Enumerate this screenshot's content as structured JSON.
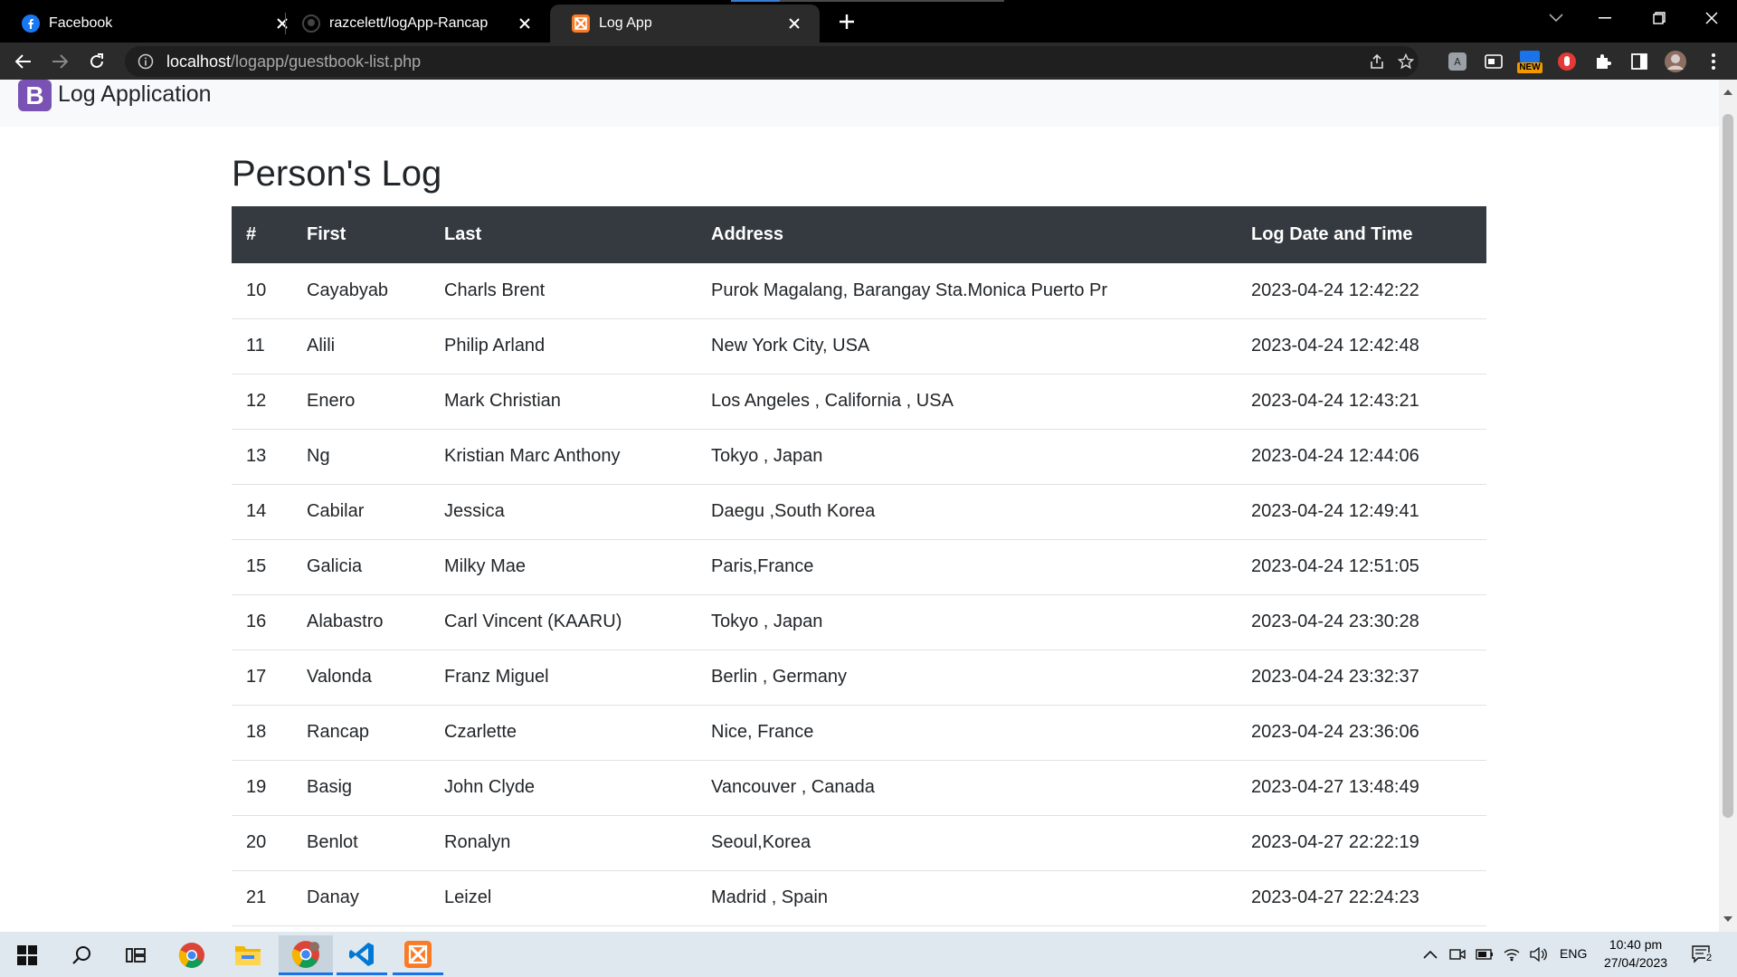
{
  "browser": {
    "tabs": [
      {
        "title": "Facebook",
        "favicon": "facebook-icon",
        "active": false
      },
      {
        "title": "razcelett/logApp-Rancap",
        "favicon": "github-icon",
        "active": false
      },
      {
        "title": "Log App",
        "favicon": "xampp-icon",
        "active": true
      }
    ],
    "url_host": "localhost",
    "url_path": "/logapp/guestbook-list.php",
    "extension_badge": "NEW"
  },
  "navbar": {
    "brand_letter": "B",
    "brand_text": "Log Application"
  },
  "page": {
    "title": "Person's Log",
    "columns": [
      "#",
      "First",
      "Last",
      "Address",
      "Log Date and Time"
    ],
    "rows": [
      {
        "id": "10",
        "first": "Cayabyab",
        "last": "Charls Brent",
        "address": "Purok Magalang, Barangay Sta.Monica Puerto Pr",
        "datetime": "2023-04-24 12:42:22"
      },
      {
        "id": "11",
        "first": "Alili",
        "last": "Philip Arland",
        "address": "New York City, USA",
        "datetime": "2023-04-24 12:42:48"
      },
      {
        "id": "12",
        "first": "Enero",
        "last": "Mark Christian",
        "address": "Los Angeles , California , USA",
        "datetime": "2023-04-24 12:43:21"
      },
      {
        "id": "13",
        "first": "Ng",
        "last": "Kristian Marc Anthony",
        "address": "Tokyo , Japan",
        "datetime": "2023-04-24 12:44:06"
      },
      {
        "id": "14",
        "first": "Cabilar",
        "last": "Jessica",
        "address": "Daegu ,South Korea",
        "datetime": "2023-04-24 12:49:41"
      },
      {
        "id": "15",
        "first": "Galicia",
        "last": "Milky Mae",
        "address": "Paris,France",
        "datetime": "2023-04-24 12:51:05"
      },
      {
        "id": "16",
        "first": "Alabastro",
        "last": "Carl Vincent (KAARU)",
        "address": "Tokyo , Japan",
        "datetime": "2023-04-24 23:30:28"
      },
      {
        "id": "17",
        "first": "Valonda",
        "last": "Franz Miguel",
        "address": "Berlin , Germany",
        "datetime": "2023-04-24 23:32:37"
      },
      {
        "id": "18",
        "first": "Rancap",
        "last": "Czarlette",
        "address": "Nice, France",
        "datetime": "2023-04-24 23:36:06"
      },
      {
        "id": "19",
        "first": "Basig",
        "last": "John Clyde",
        "address": "Vancouver , Canada",
        "datetime": "2023-04-27 13:48:49"
      },
      {
        "id": "20",
        "first": "Benlot",
        "last": "Ronalyn",
        "address": "Seoul,Korea",
        "datetime": "2023-04-27 22:22:19"
      },
      {
        "id": "21",
        "first": "Danay",
        "last": "Leizel",
        "address": "Madrid , Spain",
        "datetime": "2023-04-27 22:24:23"
      }
    ]
  },
  "taskbar": {
    "language": "ENG",
    "time": "10:40 pm",
    "date": "27/04/2023",
    "notification_count": "2"
  },
  "colors": {
    "table_header_bg": "#343a40",
    "navbar_bg": "#f8f9fa",
    "brand_purple": "#7952b3",
    "browser_dark": "#000000",
    "toolbar": "#2b2b2b"
  }
}
